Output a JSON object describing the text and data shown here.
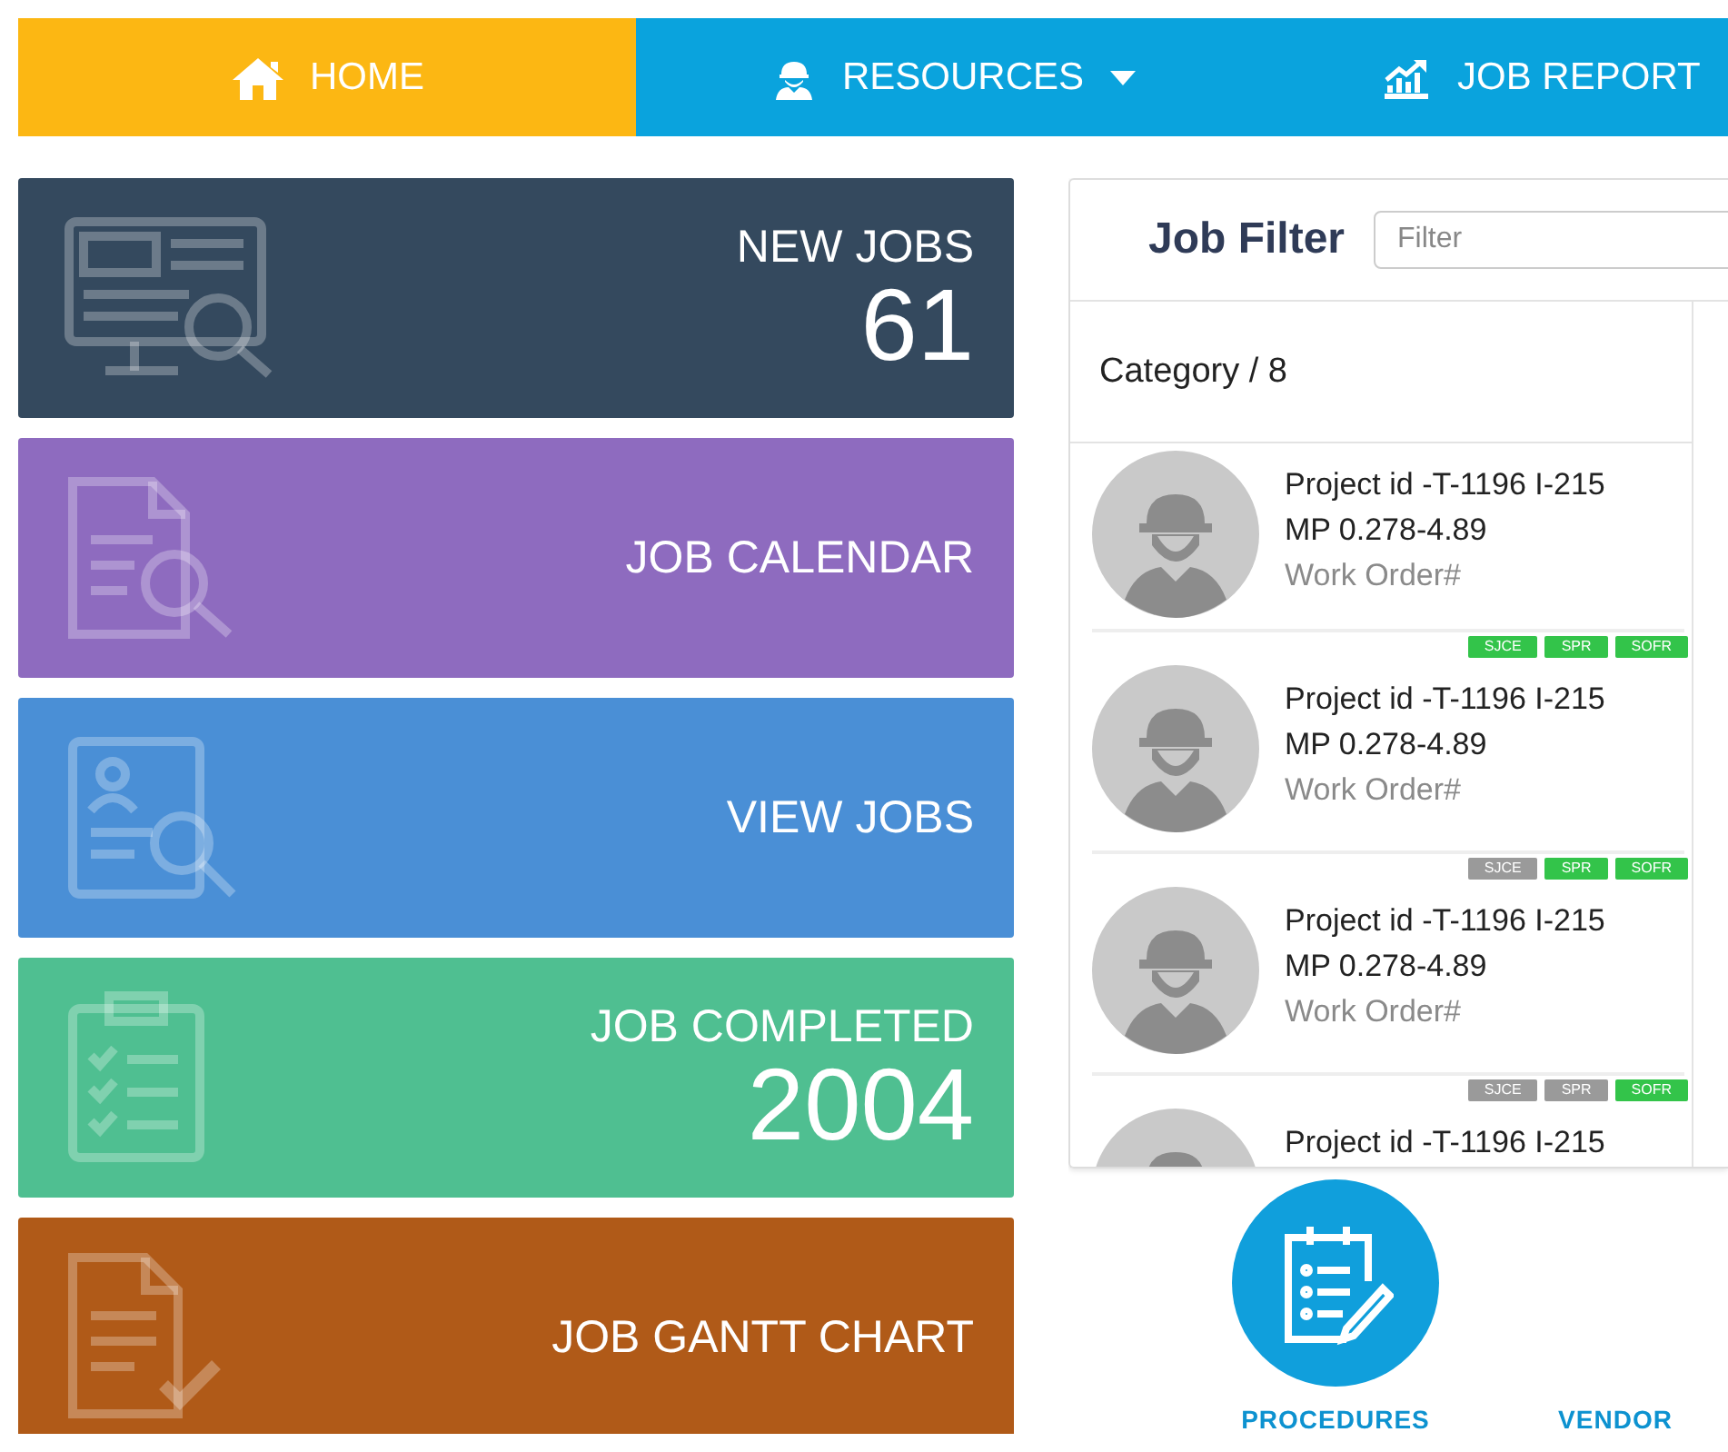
{
  "nav": [
    {
      "label": "HOME",
      "selected": true,
      "dropdown": false
    },
    {
      "label": "RESOURCES",
      "selected": false,
      "dropdown": true
    },
    {
      "label": "JOB REPORT",
      "selected": false,
      "dropdown": false
    }
  ],
  "tiles": [
    {
      "label": "NEW JOBS",
      "count": "61",
      "color": "#34495e"
    },
    {
      "label": "JOB CALENDAR",
      "color": "#8e6bbf"
    },
    {
      "label": "VIEW JOBS",
      "color": "#4a8fd6"
    },
    {
      "label": "JOB COMPLETED",
      "count": "2004",
      "color": "#4fbf91"
    },
    {
      "label": "JOB GANTT CHART",
      "color": "#b05a18"
    }
  ],
  "job_filter": {
    "title": "Job Filter",
    "search": {
      "placeholder": "Filter"
    },
    "category": "Category / 8",
    "jobs": [
      {
        "project": "Project id -T-1196 I-215",
        "mp": "MP 0.278-4.89",
        "work_order": "Work Order#"
      },
      {
        "tags": [
          {
            "label": "SJCE",
            "active": true
          },
          {
            "label": "SPR",
            "active": true
          },
          {
            "label": "SOFR",
            "active": true
          }
        ],
        "project": "Project id -T-1196 I-215",
        "mp": "MP 0.278-4.89",
        "work_order": "Work Order#"
      },
      {
        "tags": [
          {
            "label": "SJCE",
            "active": false
          },
          {
            "label": "SPR",
            "active": true
          },
          {
            "label": "SOFR",
            "active": true
          }
        ],
        "project": "Project id -T-1196 I-215",
        "mp": "MP 0.278-4.89",
        "work_order": "Work Order#"
      },
      {
        "tags": [
          {
            "label": "SJCE",
            "active": false
          },
          {
            "label": "SPR",
            "active": false
          },
          {
            "label": "SOFR",
            "active": true
          }
        ],
        "project": "Project id -T-1196 I-215"
      }
    ]
  },
  "quick_links": [
    {
      "label": "PROCEDURES"
    },
    {
      "label": "VENDOR"
    }
  ]
}
